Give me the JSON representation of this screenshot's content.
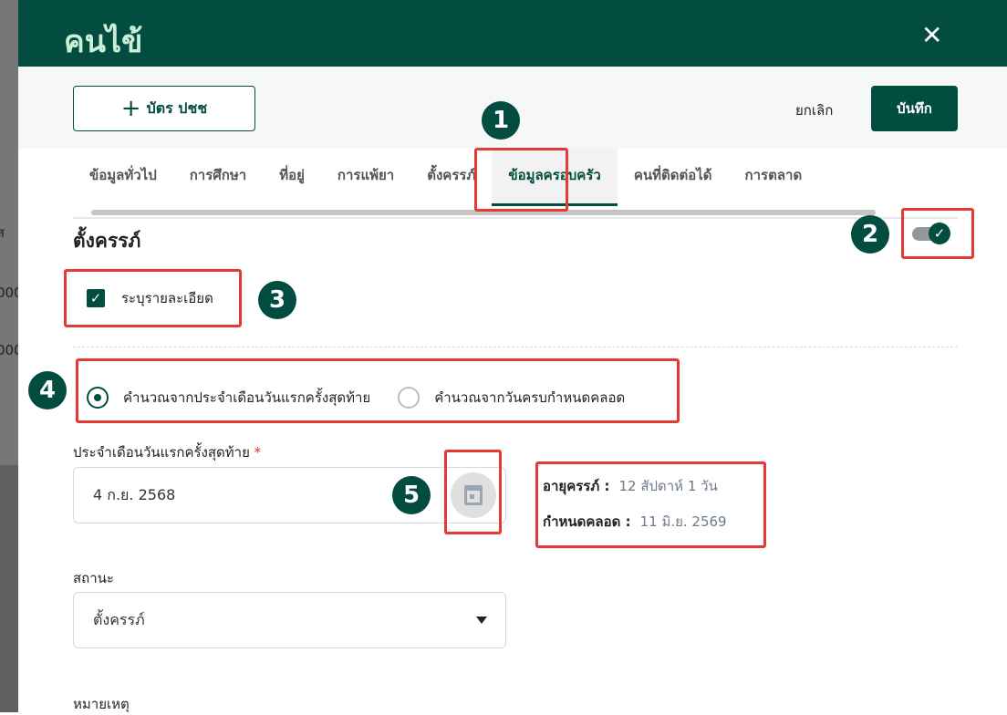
{
  "backdrop": {
    "texts": [
      "ส",
      "000",
      "000"
    ]
  },
  "header": {
    "title": "คนไข้",
    "close_icon": "close-icon"
  },
  "actions": {
    "id_card_label": "บัตร ปชช",
    "id_card_icon": "plus-icon",
    "cancel_label": "ยกเลิก",
    "save_label": "บันทึก"
  },
  "tabs": [
    {
      "label": "ข้อมูลทั่วไป"
    },
    {
      "label": "การศึกษา"
    },
    {
      "label": "ที่อยู่"
    },
    {
      "label": "การแพ้ยา"
    },
    {
      "label": "ตั้งครรภ์"
    },
    {
      "label": "ข้อมูลครอบครัว",
      "active": true
    },
    {
      "label": "คนที่ติดต่อได้"
    },
    {
      "label": "การตลาด"
    }
  ],
  "section": {
    "title": "ตั้งครรภ์",
    "toggle_on": true,
    "detail_checkbox_label": "ระบุรายละเอียด",
    "detail_checked": true
  },
  "calc_method": {
    "options": [
      "คำนวณจากประจำเดือนวันแรกครั้งสุดท้าย",
      "คำนวณจากวันครบกำหนดคลอด"
    ],
    "selected": 0
  },
  "lmp": {
    "label": "ประจำเดือนวันแรกครั้งสุดท้าย",
    "required_mark": "*",
    "value": "4 ก.ย. 2568",
    "calendar_icon": "calendar-icon"
  },
  "summary": {
    "ga_label": "อายุครรภ์ :",
    "ga_value": "12 สัปดาห์ 1 วัน",
    "edd_label": "กำหนดคลอด :",
    "edd_value": "11 มิ.ย. 2569"
  },
  "status": {
    "label": "สถานะ",
    "value": "ตั้งครรภ์"
  },
  "note": {
    "label": "หมายเหตุ"
  },
  "annotations": [
    "1",
    "2",
    "3",
    "4",
    "5"
  ],
  "colors": {
    "primary": "#024d40",
    "highlight": "#e53935"
  }
}
